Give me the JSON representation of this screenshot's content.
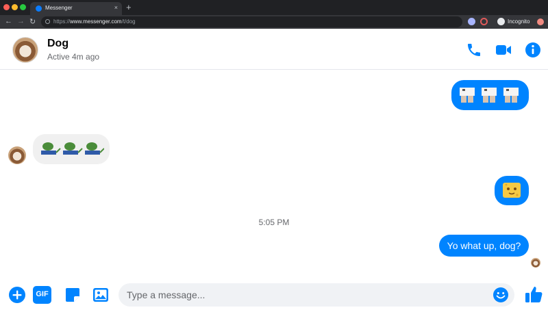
{
  "browser": {
    "tab_title": "Messenger",
    "tab_close": "×",
    "new_tab": "+",
    "url_scheme": "https://",
    "url_host": "www.messenger.com",
    "url_path": "/t/dog",
    "incognito_label": "Incognito"
  },
  "header": {
    "contact_name": "Dog",
    "status": "Active 4m ago"
  },
  "conversation": {
    "timestamp": "5:05 PM",
    "last_message": "Yo what up, dog?"
  },
  "composer": {
    "placeholder": "Type a message...",
    "gif_label": "GIF"
  },
  "colors": {
    "accent": "#0084ff",
    "incoming_bubble": "#f0f0f0",
    "chrome_dark": "#202124"
  }
}
